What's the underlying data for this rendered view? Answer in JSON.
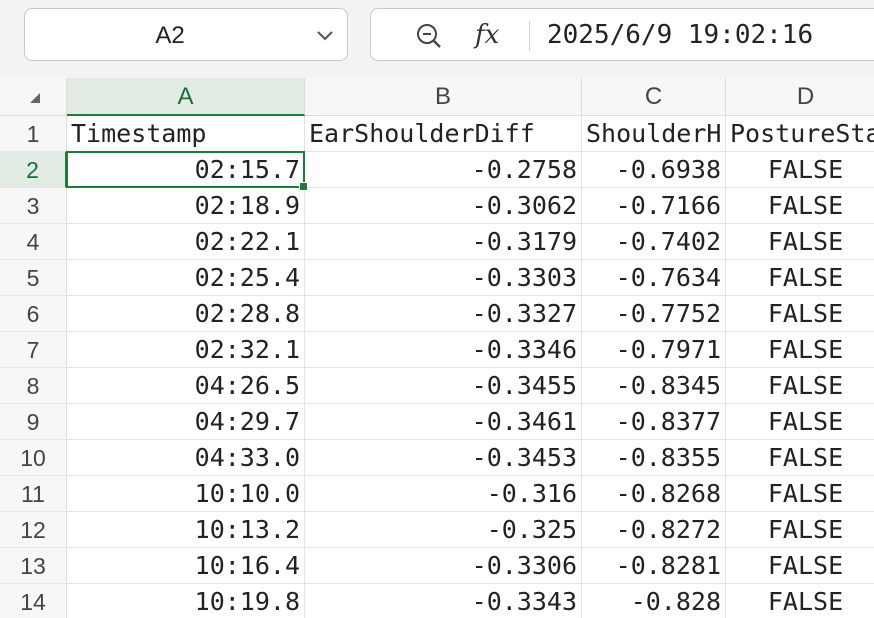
{
  "name_box": {
    "value": "A2"
  },
  "formula_bar": {
    "fx_label": "fx",
    "content": "2025/6/9 19:02:16"
  },
  "columns": [
    "A",
    "B",
    "C",
    "D"
  ],
  "rows": [
    {
      "num": "1",
      "cells": [
        "Timestamp",
        "EarShoulderDiff",
        "ShoulderH",
        "PostureSta"
      ]
    },
    {
      "num": "2",
      "cells": [
        "02:15.7",
        "-0.2758",
        "-0.6938",
        "FALSE"
      ]
    },
    {
      "num": "3",
      "cells": [
        "02:18.9",
        "-0.3062",
        "-0.7166",
        "FALSE"
      ]
    },
    {
      "num": "4",
      "cells": [
        "02:22.1",
        "-0.3179",
        "-0.7402",
        "FALSE"
      ]
    },
    {
      "num": "5",
      "cells": [
        "02:25.4",
        "-0.3303",
        "-0.7634",
        "FALSE"
      ]
    },
    {
      "num": "6",
      "cells": [
        "02:28.8",
        "-0.3327",
        "-0.7752",
        "FALSE"
      ]
    },
    {
      "num": "7",
      "cells": [
        "02:32.1",
        "-0.3346",
        "-0.7971",
        "FALSE"
      ]
    },
    {
      "num": "8",
      "cells": [
        "04:26.5",
        "-0.3455",
        "-0.8345",
        "FALSE"
      ]
    },
    {
      "num": "9",
      "cells": [
        "04:29.7",
        "-0.3461",
        "-0.8377",
        "FALSE"
      ]
    },
    {
      "num": "10",
      "cells": [
        "04:33.0",
        "-0.3453",
        "-0.8355",
        "FALSE"
      ]
    },
    {
      "num": "11",
      "cells": [
        "10:10.0",
        "-0.316",
        "-0.8268",
        "FALSE"
      ]
    },
    {
      "num": "12",
      "cells": [
        "10:13.2",
        "-0.325",
        "-0.8272",
        "FALSE"
      ]
    },
    {
      "num": "13",
      "cells": [
        "10:16.4",
        "-0.3306",
        "-0.8281",
        "FALSE"
      ]
    },
    {
      "num": "14",
      "cells": [
        "10:19.8",
        "-0.3343",
        "-0.828",
        "FALSE"
      ]
    }
  ],
  "selection": {
    "column": "A",
    "row": "2"
  },
  "colors": {
    "accent": "#1f7a3c",
    "header_bg": "#f7f7f7",
    "selected_header_bg": "#e2ece5"
  }
}
